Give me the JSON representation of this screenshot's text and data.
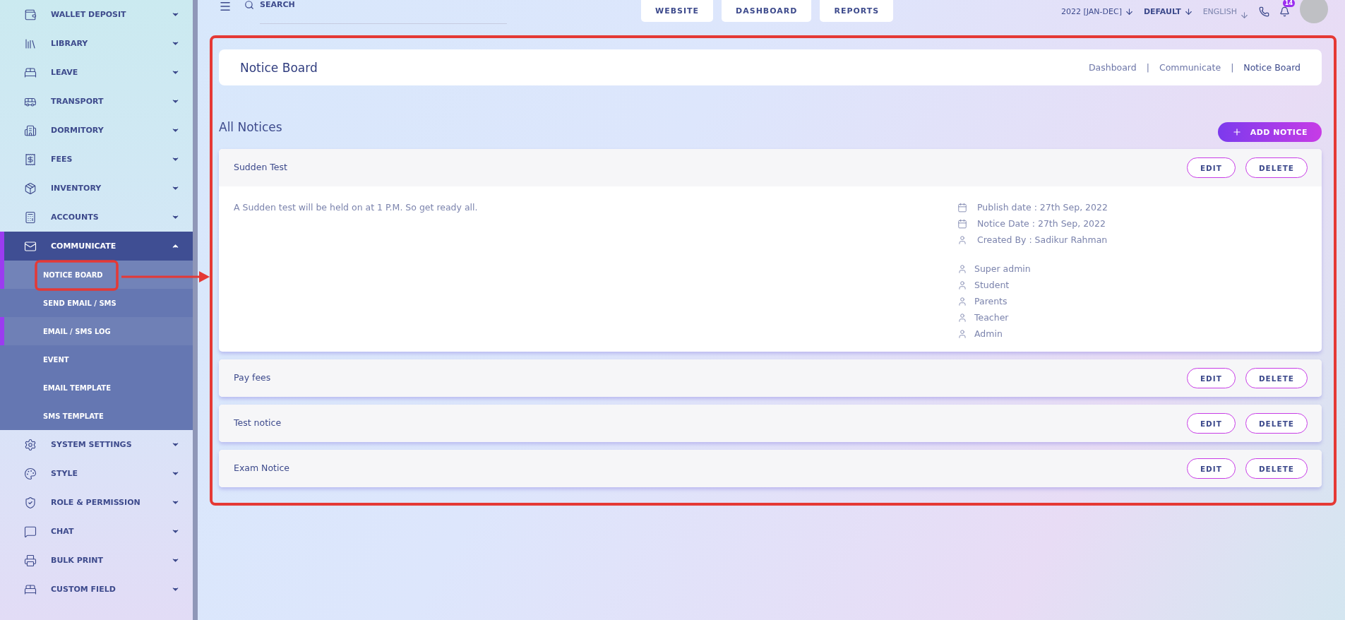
{
  "sidebar": {
    "items": [
      {
        "label": "WALLET DEPOSIT",
        "kind": "wallet",
        "expanded": false
      },
      {
        "label": "LIBRARY",
        "kind": "library",
        "expanded": false
      },
      {
        "label": "LEAVE",
        "kind": "bed",
        "expanded": false
      },
      {
        "label": "TRANSPORT",
        "kind": "bus",
        "expanded": false
      },
      {
        "label": "DORMITORY",
        "kind": "building",
        "expanded": false
      },
      {
        "label": "FEES",
        "kind": "receipt",
        "expanded": false
      },
      {
        "label": "INVENTORY",
        "kind": "package",
        "expanded": false
      },
      {
        "label": "ACCOUNTS",
        "kind": "calculator",
        "expanded": false
      },
      {
        "label": "COMMUNICATE",
        "kind": "mail",
        "expanded": true,
        "children": [
          {
            "label": "NOTICE BOARD",
            "selected": true,
            "hovered": false
          },
          {
            "label": "SEND EMAIL / SMS",
            "selected": false,
            "hovered": false
          },
          {
            "label": "EMAIL / SMS LOG",
            "selected": false,
            "hovered": true
          },
          {
            "label": "EVENT",
            "selected": false,
            "hovered": false
          },
          {
            "label": "EMAIL TEMPLATE",
            "selected": false,
            "hovered": false
          },
          {
            "label": "SMS TEMPLATE",
            "selected": false,
            "hovered": false
          }
        ]
      },
      {
        "label": "SYSTEM SETTINGS",
        "kind": "settings",
        "expanded": false
      },
      {
        "label": "STYLE",
        "kind": "palette",
        "expanded": false
      },
      {
        "label": "ROLE & PERMISSION",
        "kind": "shield",
        "expanded": false
      },
      {
        "label": "CHAT",
        "kind": "chat",
        "expanded": false
      },
      {
        "label": "BULK PRINT",
        "kind": "print",
        "expanded": false
      },
      {
        "label": "CUSTOM FIELD",
        "kind": "bed",
        "expanded": false
      }
    ]
  },
  "topbar": {
    "search": {
      "placeholder": "SEARCH"
    },
    "nav_buttons": [
      "WEBSITE",
      "DASHBOARD",
      "REPORTS"
    ],
    "session": "2022 [JAN-DEC]",
    "theme": "DEFAULT",
    "language": "ENGLISH",
    "notification_count": "14"
  },
  "page_header": {
    "title": "Notice Board",
    "breadcrumbs": [
      "Dashboard",
      "Communicate",
      "Notice Board"
    ],
    "separator": "|"
  },
  "section": {
    "title": "All Notices",
    "add_button": "ADD NOTICE"
  },
  "notices": [
    {
      "title": "Sudden Test",
      "expanded": true,
      "body": "A Sudden test will be held on at 1 P.M. So get ready all.",
      "meta": [
        {
          "kind": "date",
          "text": "Publish date : 27th Sep, 2022"
        },
        {
          "kind": "date",
          "text": "Notice Date : 27th Sep, 2022"
        },
        {
          "kind": "user",
          "text": "Created By : Sadikur Rahman"
        }
      ],
      "recipients": [
        "Super admin",
        "Student",
        "Parents",
        "Teacher",
        "Admin"
      ],
      "edit": "EDIT",
      "delete": "DELETE"
    },
    {
      "title": "Pay fees",
      "expanded": false,
      "edit": "EDIT",
      "delete": "DELETE"
    },
    {
      "title": "Test notice",
      "expanded": false,
      "edit": "EDIT",
      "delete": "DELETE"
    },
    {
      "title": "Exam Notice",
      "expanded": false,
      "edit": "EDIT",
      "delete": "DELETE"
    }
  ]
}
